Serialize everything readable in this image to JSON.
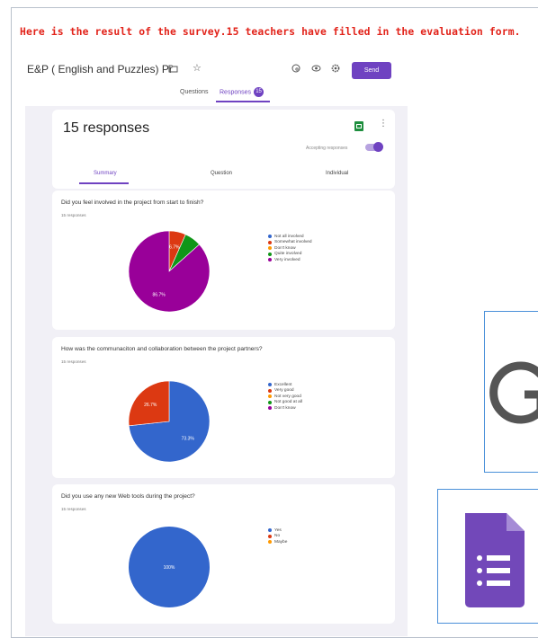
{
  "caption": "Here is the result of the survey.15 teachers have filled in the evaluation form.",
  "form": {
    "title": "E&P ( English and Puzzles) Pr",
    "send_label": "Send",
    "tabs": [
      {
        "label": "Questions"
      },
      {
        "label": "Responses",
        "badge": "15"
      }
    ],
    "responses_count": "15 responses",
    "accepting_label": "Accepting responses",
    "subtabs": [
      {
        "label": "Summary"
      },
      {
        "label": "Question"
      },
      {
        "label": "Individual"
      }
    ]
  },
  "colors": {
    "accent": "#6f42c1",
    "caption": "#e2231a",
    "background": "#f1f0f6",
    "sheets": "#1e8e3e"
  },
  "icons": [
    "folder-icon",
    "star-icon",
    "palette-icon",
    "eye-icon",
    "gear-icon",
    "sheets-icon",
    "more-vert-icon",
    "google-g-logo",
    "google-forms-logo"
  ],
  "chart_data": [
    {
      "type": "pie",
      "title": "Did you feel involved in the project from start to finish?",
      "subtitle": "15 responses",
      "categories": [
        "Not all involved",
        "Somewhat involved",
        "Don't know",
        "Quite involved",
        "Very involved"
      ],
      "values": [
        0,
        6.7,
        0,
        6.7,
        86.7
      ],
      "slice_labels": [
        "",
        "6.7%",
        "",
        "",
        "86.7%"
      ],
      "colors": [
        "#3366cc",
        "#dc3912",
        "#ff9900",
        "#109618",
        "#990099"
      ],
      "legend": "right"
    },
    {
      "type": "pie",
      "title": "How was the communaciton and collaboration between the project partners?",
      "subtitle": "15 responses",
      "categories": [
        "Excellent",
        "Very good",
        "Not very good",
        "Not good at all",
        "Don't know"
      ],
      "values": [
        73.3,
        26.7,
        0,
        0,
        0
      ],
      "slice_labels": [
        "73.3%",
        "26.7%",
        "",
        "",
        ""
      ],
      "colors": [
        "#3366cc",
        "#dc3912",
        "#ff9900",
        "#109618",
        "#990099"
      ],
      "legend": "right"
    },
    {
      "type": "pie",
      "title": "Did you use any new Web tools during the project?",
      "subtitle": "15 responses",
      "categories": [
        "Yes",
        "No",
        "Maybe"
      ],
      "values": [
        100,
        0,
        0
      ],
      "slice_labels": [
        "100%",
        "",
        ""
      ],
      "colors": [
        "#3366cc",
        "#dc3912",
        "#ff9900"
      ],
      "legend": "right"
    }
  ]
}
